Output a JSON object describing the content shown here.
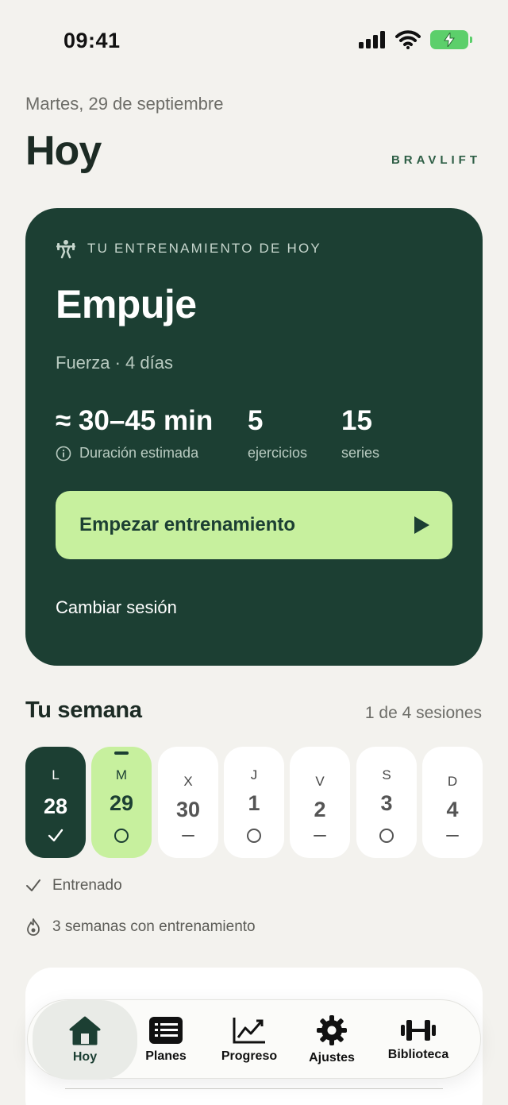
{
  "status_bar": {
    "time": "09:41"
  },
  "header": {
    "date": "Martes, 29 de septiembre",
    "title": "Hoy",
    "brand": "BRAVLIFT"
  },
  "workout": {
    "eyebrow": "TU ENTRENAMIENTO DE HOY",
    "name": "Empuje",
    "meta": "Fuerza · 4 días",
    "duration_value": "≈ 30–45 min",
    "duration_label": "Duración estimada",
    "exercises_value": "5",
    "exercises_label": "ejercicios",
    "sets_value": "15",
    "sets_label": "series",
    "start_label": "Empezar entrenamiento",
    "change_label": "Cambiar sesión"
  },
  "week": {
    "title": "Tu semana",
    "progress": "1 de 4 sesiones",
    "days": [
      {
        "letter": "L",
        "number": "28",
        "state": "done"
      },
      {
        "letter": "M",
        "number": "29",
        "state": "today"
      },
      {
        "letter": "X",
        "number": "30",
        "state": "rest"
      },
      {
        "letter": "J",
        "number": "1",
        "state": "planned"
      },
      {
        "letter": "V",
        "number": "2",
        "state": "rest"
      },
      {
        "letter": "S",
        "number": "3",
        "state": "planned"
      },
      {
        "letter": "D",
        "number": "4",
        "state": "rest"
      }
    ],
    "legend_trained": "Entrenado",
    "streak": "3 semanas con entrenamiento"
  },
  "next_card": {
    "title": ""
  },
  "nav": {
    "items": [
      {
        "label": "Hoy",
        "icon": "home-icon",
        "active": true
      },
      {
        "label": "Planes",
        "icon": "list-icon",
        "active": false
      },
      {
        "label": "Progreso",
        "icon": "chart-icon",
        "active": false
      },
      {
        "label": "Ajustes",
        "icon": "gear-icon",
        "active": false
      },
      {
        "label": "Biblioteca",
        "icon": "dumbbell-icon",
        "active": false
      }
    ]
  },
  "colors": {
    "background": "#f3f2ee",
    "card_dark": "#1c3f33",
    "accent_lime": "#c7f09e",
    "battery": "#5ccf6b"
  }
}
